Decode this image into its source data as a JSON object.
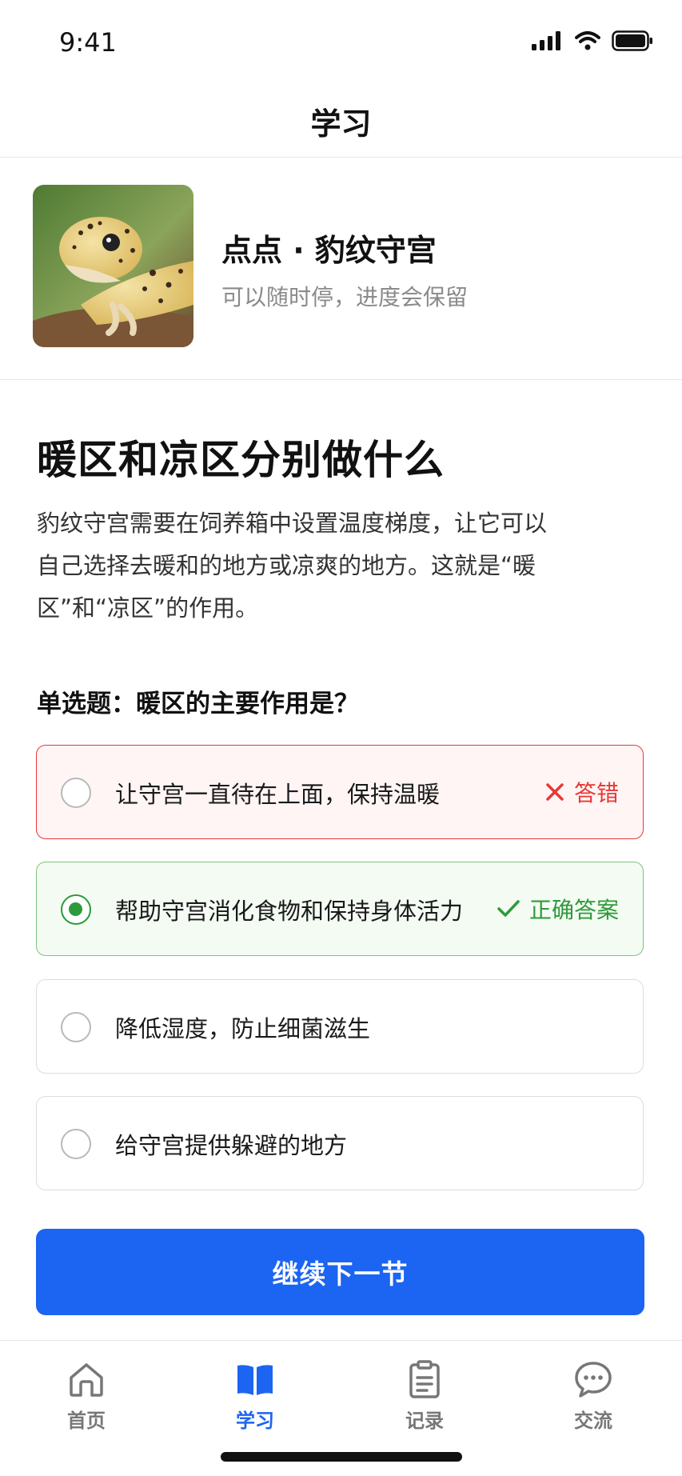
{
  "status": {
    "time": "9:41"
  },
  "nav": {
    "title": "学习"
  },
  "pet": {
    "name": "点点 · 豹纹守宫",
    "subtitle": "可以随时停，进度会保留"
  },
  "lesson": {
    "title": "暖区和凉区分别做什么",
    "body_lines": [
      "豹纹守宫需要在饲养箱中设置温度梯度，让它可以",
      "自己选择去暖和的地方或凉爽的地方。这就是“暖",
      "区”和“凉区”的作用。"
    ]
  },
  "quiz": {
    "question": "单选题：暖区的主要作用是？",
    "options": [
      {
        "text": "让守宫一直待在上面，保持温暖",
        "status": "答错",
        "state": "wrong",
        "selected": false
      },
      {
        "text": "帮助守宫消化食物和保持身体活力",
        "status": "正确答案",
        "state": "correct",
        "selected": true
      },
      {
        "text": "降低湿度，防止细菌滋生",
        "status": "",
        "state": "neutral",
        "selected": false
      },
      {
        "text": "给守宫提供躲避的地方",
        "status": "",
        "state": "neutral",
        "selected": false
      }
    ]
  },
  "cta": {
    "label": "继续下一节"
  },
  "tabs": [
    {
      "label": "首页",
      "icon": "home-icon",
      "active": false
    },
    {
      "label": "学习",
      "icon": "book-icon",
      "active": true
    },
    {
      "label": "记录",
      "icon": "clipboard-icon",
      "active": false
    },
    {
      "label": "交流",
      "icon": "chat-icon",
      "active": false
    }
  ],
  "colors": {
    "accent": "#1c64f2",
    "wrong": "#e53935",
    "correct": "#2e9a3a"
  }
}
